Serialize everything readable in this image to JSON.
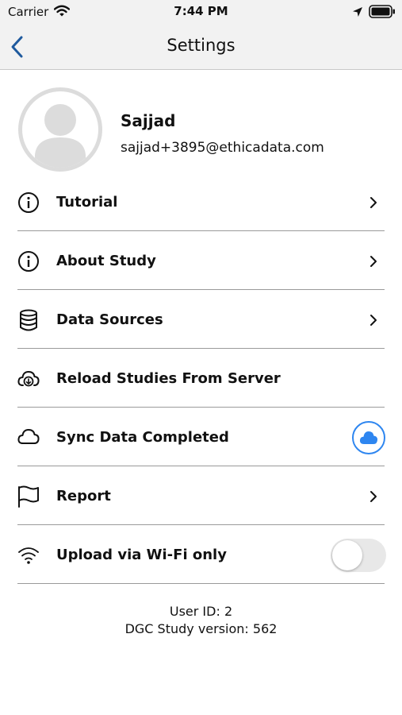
{
  "status_bar": {
    "carrier": "Carrier",
    "time": "7:44 PM",
    "icons": [
      "wifi-icon",
      "location-arrow-icon",
      "battery-icon"
    ]
  },
  "nav": {
    "title": "Settings",
    "back_icon": "chevron-left-icon"
  },
  "profile": {
    "name": "Sajjad",
    "email": "sajjad+3895@ethicadata.com",
    "avatar_icon": "user-silhouette-icon"
  },
  "settings": {
    "tutorial": {
      "label": "Tutorial",
      "icon": "info-circle-icon"
    },
    "about": {
      "label": "About Study",
      "icon": "info-circle-icon"
    },
    "data_sources": {
      "label": "Data Sources",
      "icon": "database-icon"
    },
    "reload": {
      "label": "Reload Studies From Server",
      "icon": "cloud-download-icon"
    },
    "sync": {
      "label": "Sync Data Completed",
      "icon": "cloud-icon",
      "status_icon": "cloud-filled-icon"
    },
    "report": {
      "label": "Report",
      "icon": "flag-icon"
    },
    "wifi_only": {
      "label": "Upload via Wi-Fi only",
      "icon": "wifi-icon",
      "enabled": false
    }
  },
  "footer": {
    "user_id": "User ID: 2",
    "study_version": "DGC Study version: 562"
  },
  "colors": {
    "accent": "#2e86f0",
    "divider": "#9a9a9a",
    "bar_background": "#f2f2f2"
  }
}
